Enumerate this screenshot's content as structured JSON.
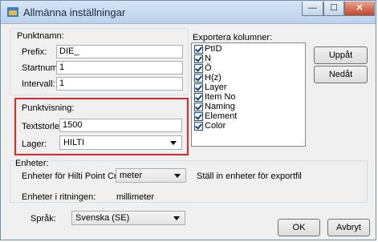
{
  "window": {
    "title": "Allmänna inställningar",
    "min_label": "—",
    "max_label": "☐",
    "close_label": "✕"
  },
  "punktnamn": {
    "group_label": "Punktnamn:",
    "prefix_label": "Prefix:",
    "prefix_value": "DIE_",
    "start_label": "Startnumme",
    "start_value": "1",
    "interval_label": "Intervall:",
    "interval_value": "1"
  },
  "punktvisning": {
    "group_label": "Punktvisning:",
    "textsize_label": "Textstorlek:",
    "textsize_value": "1500",
    "layer_label": "Lager:",
    "layer_value": "HILTI"
  },
  "export": {
    "label": "Exportera kolumner:",
    "columns": [
      {
        "label": "PtID",
        "checked": true
      },
      {
        "label": "N",
        "checked": true
      },
      {
        "label": "Ö",
        "checked": true
      },
      {
        "label": "H(z)",
        "checked": true
      },
      {
        "label": "Layer",
        "checked": true
      },
      {
        "label": "Item No",
        "checked": true
      },
      {
        "label": "Naming",
        "checked": true
      },
      {
        "label": "Element",
        "checked": true
      },
      {
        "label": "Color",
        "checked": true
      }
    ],
    "up_label": "Uppåt",
    "down_label": "Nedåt"
  },
  "units": {
    "group_label": "Enheter:",
    "creator_label": "Enheter för Hilti Point Creator:",
    "creator_value": "meter",
    "hint": "Ställ in enheter för exportfil",
    "drawing_label": "Enheter i ritningen:",
    "drawing_value": "millimeter"
  },
  "language": {
    "label": "Språk:",
    "value": "Svenska (SE)"
  },
  "footer": {
    "ok_label": "OK",
    "cancel_label": "Avbryt"
  }
}
